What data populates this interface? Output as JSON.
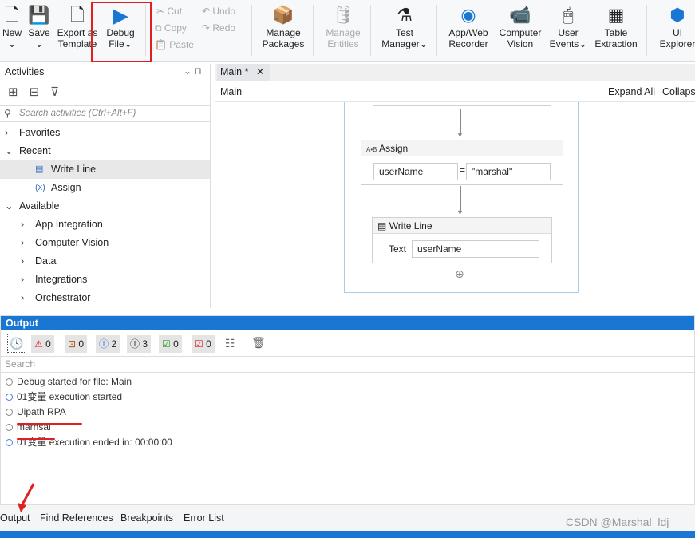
{
  "toolbar": {
    "new": "New",
    "save": "Save",
    "export": "Export as",
    "export2": "Template",
    "debug": "Debug",
    "debug2": "File",
    "cut": "Cut",
    "copy": "Copy",
    "paste": "Paste",
    "undo": "Undo",
    "redo": "Redo",
    "manage_packages": "Manage",
    "manage_packages2": "Packages",
    "manage_entities": "Manage",
    "manage_entities2": "Entities",
    "test_manager": "Test",
    "test_manager2": "Manager",
    "recorder": "App/Web",
    "recorder2": "Recorder",
    "cv": "Computer",
    "cv2": "Vision",
    "user_events": "User",
    "user_events2": "Events",
    "table": "Table",
    "table2": "Extraction",
    "ui_explorer": "UI",
    "ui_explorer2": "Explorer"
  },
  "activities": {
    "title": "Activities",
    "search_placeholder": "Search activities (Ctrl+Alt+F)",
    "items": [
      {
        "label": "Favorites",
        "level": 0,
        "arrow": "›"
      },
      {
        "label": "Recent",
        "level": 0,
        "arrow": "⌄"
      },
      {
        "label": "Write Line",
        "level": 1,
        "selected": true
      },
      {
        "label": "Assign",
        "level": 1
      },
      {
        "label": "Available",
        "level": 0,
        "arrow": "⌄"
      },
      {
        "label": "App Integration",
        "level": 1,
        "arrow": "›"
      },
      {
        "label": "Computer Vision",
        "level": 1,
        "arrow": "›"
      },
      {
        "label": "Data",
        "level": 1,
        "arrow": "›"
      },
      {
        "label": "Integrations",
        "level": 1,
        "arrow": "›"
      },
      {
        "label": "Orchestrator",
        "level": 1,
        "arrow": "›"
      }
    ]
  },
  "designer": {
    "tab": "Main *",
    "breadcrumb": "Main",
    "expand_all": "Expand All",
    "collapse_all": "Collaps",
    "assign": {
      "title": "Assign",
      "to": "userName",
      "eq": "=",
      "value": "\"marshal\""
    },
    "writeline": {
      "title": "Write Line",
      "label": "Text",
      "value": "userName"
    }
  },
  "output": {
    "title": "Output",
    "search_placeholder": "Search",
    "filters": {
      "errors": "0",
      "warnings": "0",
      "info": "2",
      "trace": "3",
      "success": "0",
      "fail": "0"
    },
    "lines": [
      {
        "text": "Debug started for file: Main",
        "type": "trace"
      },
      {
        "text": "01变量 execution started",
        "type": "info"
      },
      {
        "text": "Uipath RPA",
        "type": "trace"
      },
      {
        "text": "marhsal",
        "type": "trace"
      },
      {
        "text": "01变量 execution ended in: 00:00:00",
        "type": "info"
      }
    ]
  },
  "bottom_tabs": [
    "Output",
    "Find References",
    "Breakpoints",
    "Error List"
  ],
  "watermark": "CSDN @Marshal_ldj",
  "colors": {
    "accent": "#1976d2",
    "highlight": "#e02020"
  }
}
